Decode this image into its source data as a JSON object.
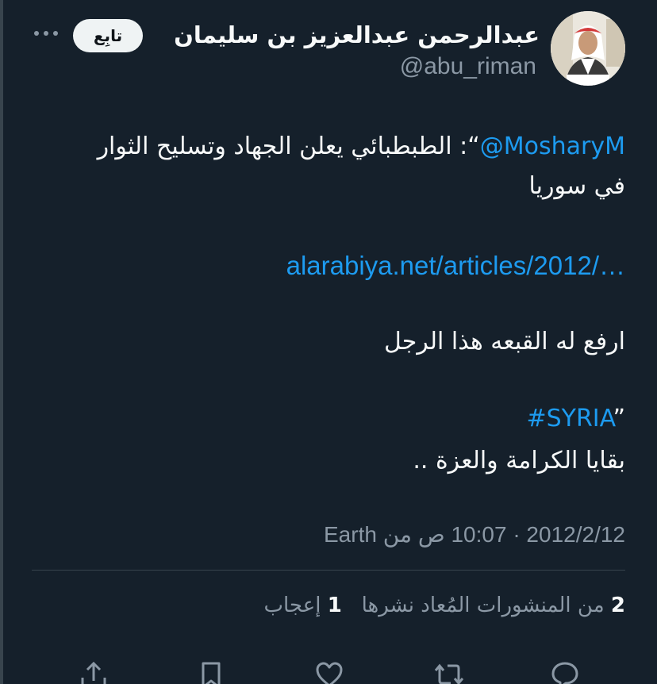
{
  "author": {
    "display_name": "عبدالرحمن عبدالعزيز بن سليمان",
    "handle": "@abu_riman"
  },
  "follow_label": "تابِع",
  "tweet": {
    "quote_open": "“",
    "mention": "@MosharyM",
    "line1_text": ": الطبطبائي يعلن الجهاد وتسليح الثوار",
    "line2_text": "في سوريا",
    "link_text": "alarabiya.net/articles/2012/…",
    "line4_text": "ارفع له القبعه هذا الرجل",
    "hashtag": "#SYRIA",
    "quote_close": "”",
    "line6_text": "بقايا الكرامة والعزة .."
  },
  "meta": {
    "date": "2012/2/12",
    "separator": "·",
    "time": "10:07 ص",
    "source_prefix": "من",
    "source": "Earth"
  },
  "stats": {
    "retweets_count": "2",
    "retweets_label": "من المنشورات المُعاد نشرها",
    "likes_count": "1",
    "likes_label": "إعجاب"
  },
  "colors": {
    "background": "#15202b",
    "text": "#f7f9f9",
    "secondary": "#8b98a5",
    "accent": "#1d9bf0",
    "divider": "#38444d"
  },
  "icons": [
    "more-horizontal-icon",
    "reply-icon",
    "retweet-icon",
    "like-icon",
    "bookmark-icon",
    "share-icon"
  ]
}
